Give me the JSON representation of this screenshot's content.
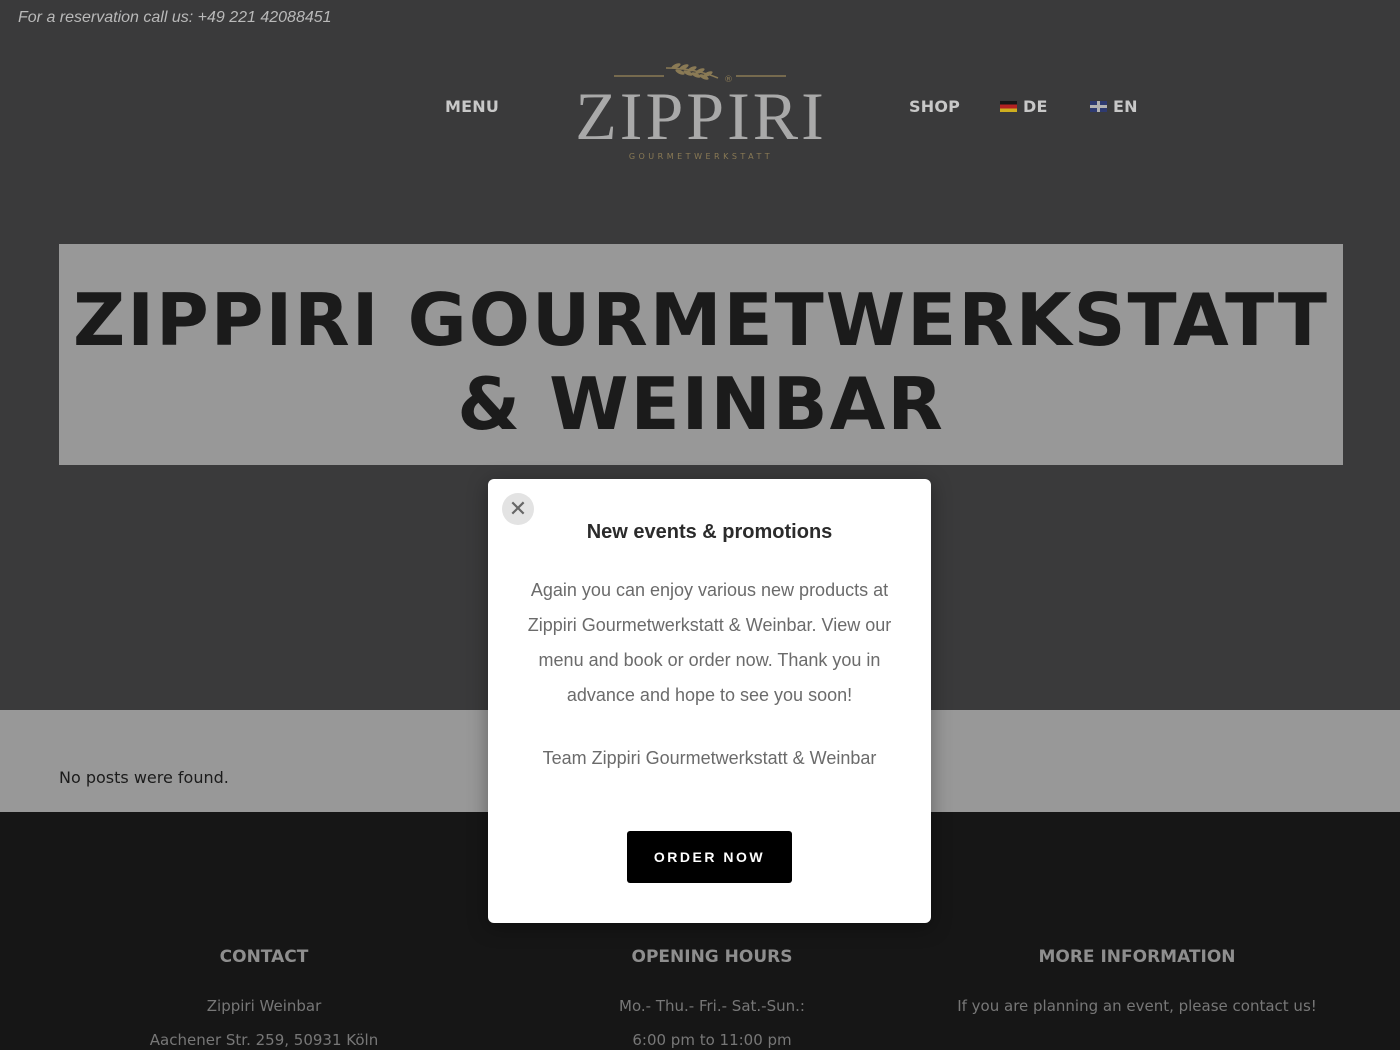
{
  "topbar": {
    "reservation_text": "For a reservation call us: +49 221 42088451"
  },
  "nav": {
    "menu": "MENU",
    "shop": "SHOP",
    "lang_de": "DE",
    "lang_en": "EN"
  },
  "logo": {
    "word": "ZIPPIRI",
    "subtitle": "GOURMETWERKSTATT",
    "registered": "®"
  },
  "hero": {
    "title_line1": "ZIPPIRI GOURMETWERKSTATT",
    "title_line2": "& WEINBAR"
  },
  "posts": {
    "empty_message": "No posts were found."
  },
  "modal": {
    "close_symbol": "✕",
    "title": "New events & promotions",
    "body": "Again you can enjoy various new products at Zippiri Gourmetwerkstatt & Weinbar. View our menu and book or order now. Thank you in advance and hope to see you soon!",
    "signature": "Team Zippiri Gourmetwerkstatt & Weinbar",
    "button_label": "ORDER NOW"
  },
  "footer": {
    "contact": {
      "heading": "CONTACT",
      "line1": "Zippiri Weinbar",
      "line2": "Aachener Str. 259, 50931 Köln"
    },
    "hours": {
      "heading": "OPENING HOURS",
      "line1": "Mo.- Thu.- Fri.- Sat.-Sun.:",
      "line2": "6:00 pm to 11:00 pm"
    },
    "info": {
      "heading": "MORE INFORMATION",
      "line1": "If you are planning an event, please contact us!"
    }
  },
  "colors": {
    "header_bg": "#3a3a3b",
    "hero_bg": "#989898",
    "footer_bg": "#161616",
    "logo_gold": "#8a7a55",
    "button_bg": "#000000"
  }
}
